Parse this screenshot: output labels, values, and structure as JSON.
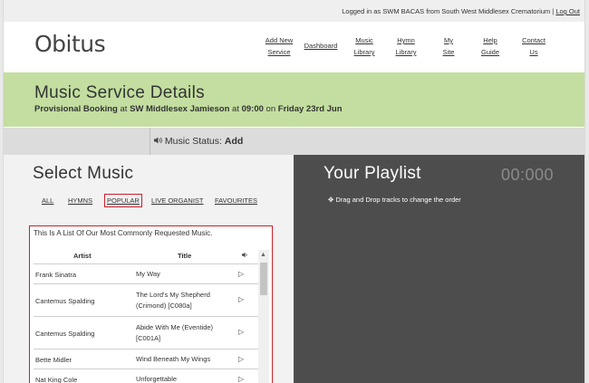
{
  "topbar": {
    "login_text": "Logged in as SWM BACAS from South West Middlesex Crematorium |",
    "logout_label": "Log Out"
  },
  "header": {
    "logo": "Obitus",
    "nav": [
      {
        "line1": "Add New",
        "line2": "Service"
      },
      {
        "line1": "Dashboard",
        "line2": ""
      },
      {
        "line1": "Music",
        "line2": "Library"
      },
      {
        "line1": "Hymn",
        "line2": "Library"
      },
      {
        "line1": "My",
        "line2": "Site"
      },
      {
        "line1": "Help",
        "line2": "Guide"
      },
      {
        "line1": "Contact",
        "line2": "Us"
      }
    ]
  },
  "banner": {
    "title": "Music Service Details",
    "booking_prefix": "Provisional Booking",
    "at1": " at ",
    "location": "SW Middlesex Jamieson",
    "at2": " at ",
    "time": "09:00",
    "on": " on ",
    "date": "Friday 23rd Jun"
  },
  "status": {
    "label": "Music Status:",
    "value": "Add",
    "icon": "speaker-icon"
  },
  "select_music": {
    "heading": "Select Music",
    "tabs": [
      "ALL",
      "HYMNS",
      "POPULAR",
      "LIVE ORGANIST",
      "FAVOURITES"
    ],
    "active_tab": "POPULAR",
    "caption": "This Is A List Of Our Most Commonly Requested Music.",
    "columns": {
      "artist": "Artist",
      "title": "Title"
    },
    "rows": [
      {
        "artist": "Frank Sinatra",
        "title": "My Way"
      },
      {
        "artist": "Cantemus Spalding",
        "title": "The Lord's My Shepherd (Crimond) [C080a]"
      },
      {
        "artist": "Cantemus Spalding",
        "title": "Abide With Me (Eventide) [C001A]"
      },
      {
        "artist": "Bette Midler",
        "title": "Wind Beneath My Wings"
      },
      {
        "artist": "Nat King Cole",
        "title": "Unforgettable"
      }
    ]
  },
  "playlist": {
    "heading": "Your Playlist",
    "timer": "00:000",
    "hint": "Drag and Drop tracks to change the order"
  },
  "colors": {
    "banner": "#c3dea0",
    "highlight": "#cc1f2a",
    "playlist_bg": "#4d4d4d"
  }
}
